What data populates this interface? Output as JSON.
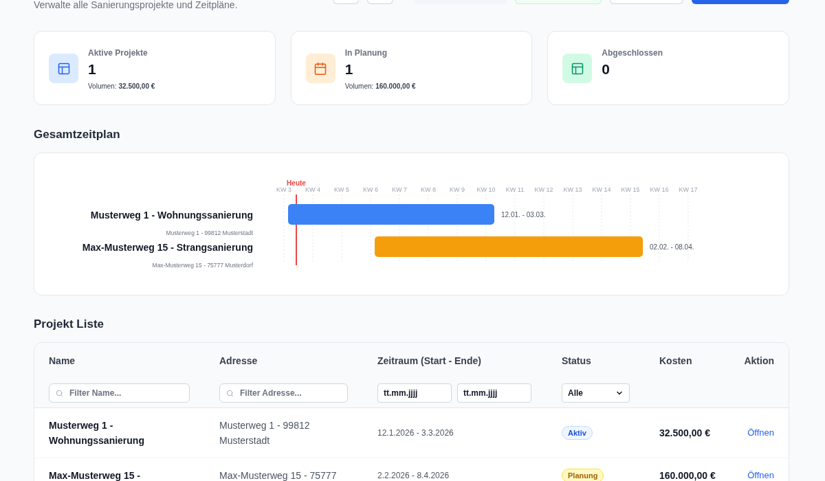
{
  "header": {
    "subtitle": "Verwalte alle Sanierungsprojekte und Zeitpläne.",
    "buttons": [
      {
        "kind": "icon"
      },
      {
        "kind": "icon"
      },
      {
        "kind": "muted"
      },
      {
        "kind": "success"
      },
      {
        "kind": "outline"
      },
      {
        "kind": "primary"
      }
    ]
  },
  "stats": [
    {
      "kind": "active",
      "label": "Aktive Projekte",
      "value": "1",
      "volume": "Volumen: **32.500,00 €**"
    },
    {
      "kind": "planning",
      "label": "In Planung",
      "value": "1",
      "volume": "Volumen: **160.000,00 €**"
    },
    {
      "kind": "done",
      "label": "Abgeschlossen",
      "value": "0"
    }
  ],
  "timeline": {
    "heading": "Gesamtzeitplan",
    "weeks": [
      "KW 3",
      "KW 4",
      "KW 5",
      "KW 6",
      "KW 7",
      "KW 8",
      "KW 9",
      "KW 10",
      "KW 11",
      "KW 12",
      "KW 13",
      "KW 14",
      "KW 15",
      "KW 16",
      "KW 17"
    ],
    "today": "Heute",
    "projects": [
      {
        "title": "Musterweg 1 - Wohnungssanierung",
        "address": "Musterweg 1 - 99812 Musterstadt",
        "range": "12.01. - 03.03.",
        "color": "#3b82f6"
      },
      {
        "title": "Max-Musterweg 15 - Strangsanierung",
        "address": "Max-Musterweg 15 - 75777 Musterdorf",
        "range": "02.02. - 08.04.",
        "color": "#f59e0b"
      }
    ]
  },
  "projects": {
    "heading": "Projekt Liste",
    "columns": [
      "Name",
      "Adresse",
      "Zeitraum (Start - Ende)",
      "Status",
      "Kosten",
      "Aktion"
    ],
    "filters": {
      "name": {
        "placeholder": "Filter Name..."
      },
      "address": {
        "placeholder": "Filter Adresse..."
      },
      "date_from": {
        "placeholder": "tt.mm.jjjj"
      },
      "date_to": {
        "placeholder": "tt.mm.jjjj"
      },
      "status": {
        "value": "Alle"
      }
    },
    "rows": [
      {
        "name": "Musterweg 1 - Wohnungssanierung",
        "address": "Musterweg 1 - 99812 Musterstadt",
        "period": "12.1.2026 - 3.3.2026",
        "status": {
          "kind": "active",
          "label": "Aktiv"
        },
        "cost": "32.500,00 €",
        "action": "Öffnen"
      },
      {
        "name": "Max-Musterweg 15 -",
        "address": "Max-Musterweg 15 - 75777",
        "period": "2.2.2026 - 8.4.2026",
        "status": {
          "kind": "planning",
          "label": "Planung"
        },
        "cost": "160.000,00 €",
        "action": "Öffnen"
      }
    ]
  }
}
